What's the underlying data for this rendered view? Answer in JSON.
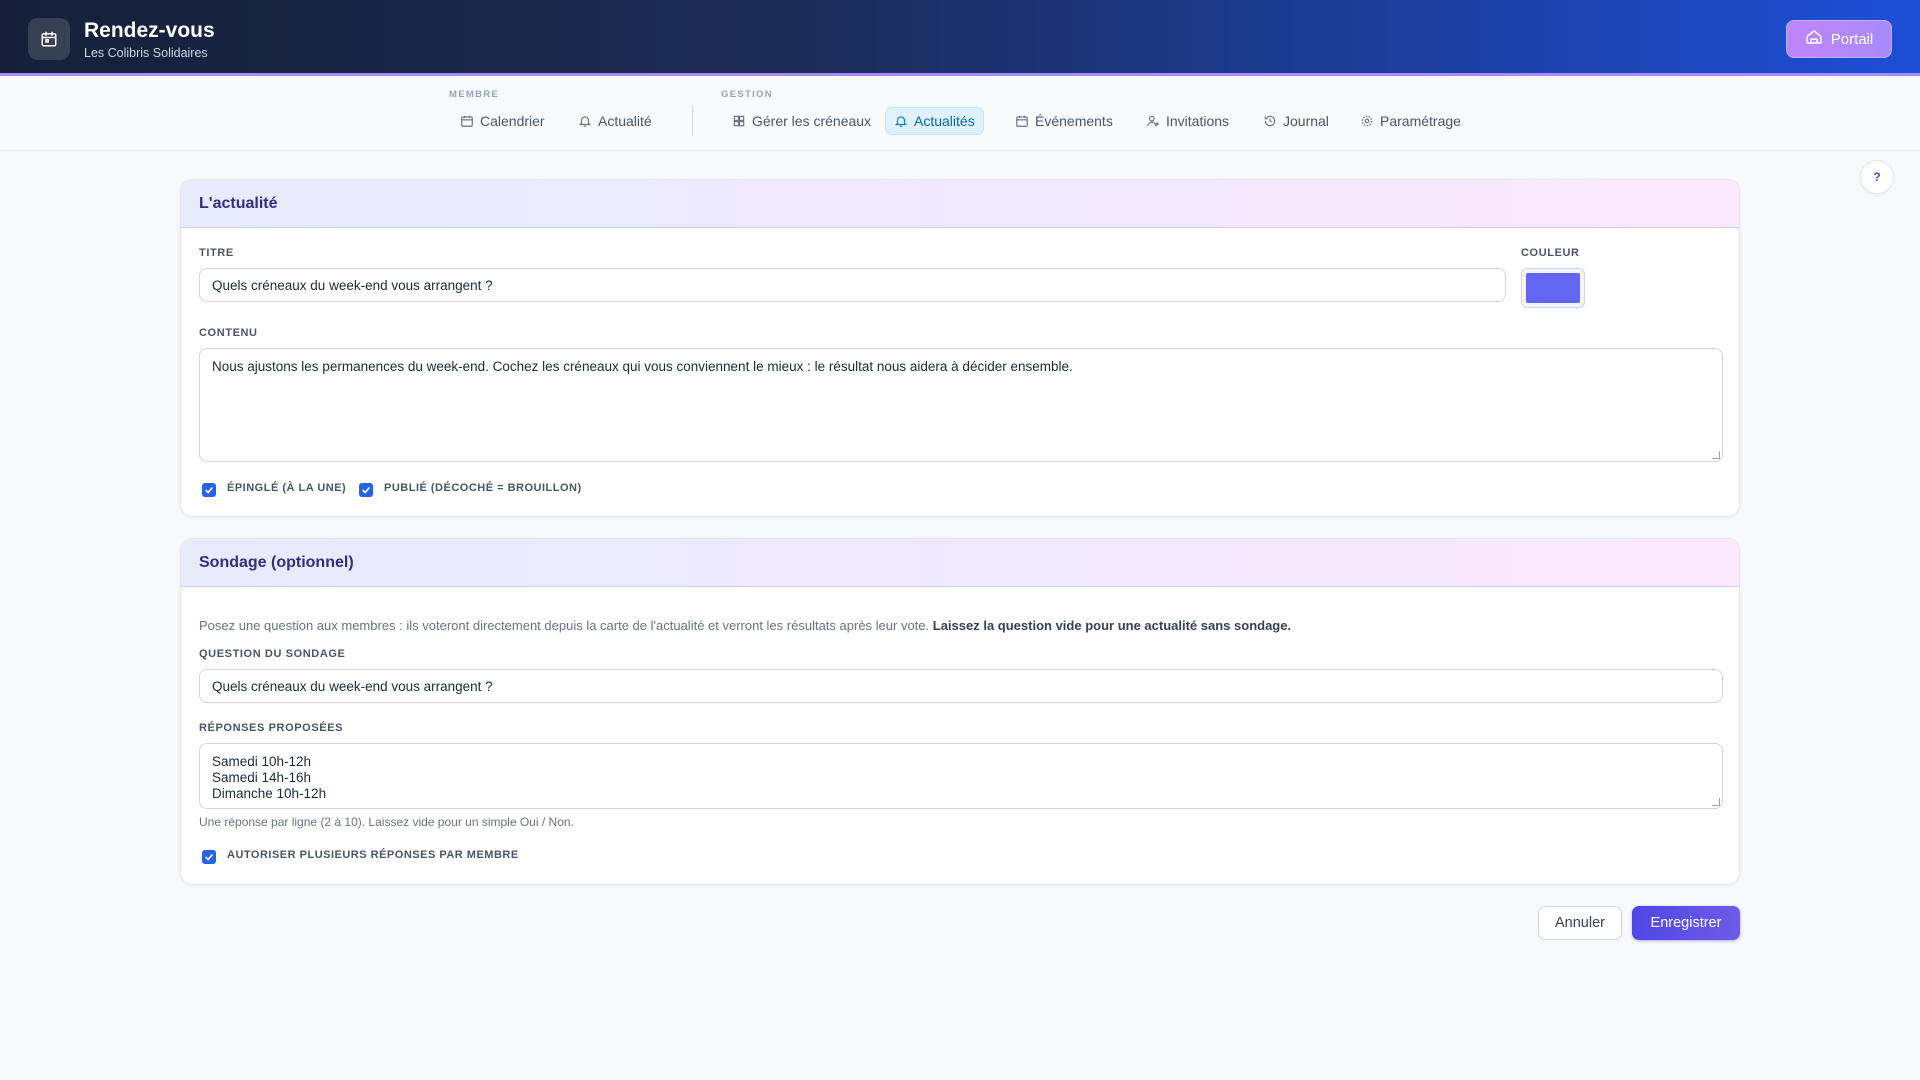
{
  "app": {
    "title": "Rendez-vous",
    "subtitle": "Les Colibris Solidaires",
    "portal_label": "Portail"
  },
  "nav": {
    "member_group": "MEMBRE",
    "manage_group": "GESTION",
    "items": [
      {
        "label": "Calendrier",
        "icon": "calendar-icon"
      },
      {
        "label": "Actualité",
        "icon": "bell-icon"
      },
      {
        "label": "Gérer les créneaux",
        "icon": "grid-icon"
      },
      {
        "label": "Actualités",
        "icon": "bell-icon",
        "active": true
      },
      {
        "label": "Événements",
        "icon": "calendar-icon"
      },
      {
        "label": "Invitations",
        "icon": "user-plus-icon"
      },
      {
        "label": "Journal",
        "icon": "history-icon"
      },
      {
        "label": "Paramétrage",
        "icon": "gear-icon"
      }
    ]
  },
  "help_label": "?",
  "news_card": {
    "heading": "L'actualité",
    "title_label": "TITRE",
    "title_value": "Quels créneaux du week-end vous arrangent ?",
    "color_label": "COULEUR",
    "color_value": "#6366f1",
    "content_label": "CONTENU",
    "content_value": "Nous ajustons les permanences du week-end. Cochez les créneaux qui vous conviennent le mieux : le résultat nous aidera à décider ensemble.",
    "pinned_label": "ÉPINGLÉ (À LA UNE)",
    "pinned_checked": true,
    "published_label": "PUBLIÉ (DÉCOCHÉ = BROUILLON)",
    "published_checked": true
  },
  "poll_card": {
    "heading": "Sondage (optionnel)",
    "intro": "Posez une question aux membres : ils voteront directement depuis la carte de l'actualité et verront les résultats après leur vote.",
    "intro_bold": "Laissez la question vide pour une actualité sans sondage.",
    "question_label": "QUESTION DU SONDAGE",
    "question_value": "Quels créneaux du week-end vous arrangent ?",
    "answers_label": "RÉPONSES PROPOSÉES",
    "answers": [
      "Samedi 10h-12h",
      "Samedi 14h-16h",
      "Dimanche 10h-12h"
    ],
    "answers_hint": "Une réponse par ligne (2 à 10). Laissez vide pour un simple Oui / Non.",
    "multi_label": "AUTORISER PLUSIEURS RÉPONSES PAR MEMBRE",
    "multi_checked": true
  },
  "actions": {
    "cancel_label": "Annuler",
    "save_label": "Enregistrer"
  }
}
